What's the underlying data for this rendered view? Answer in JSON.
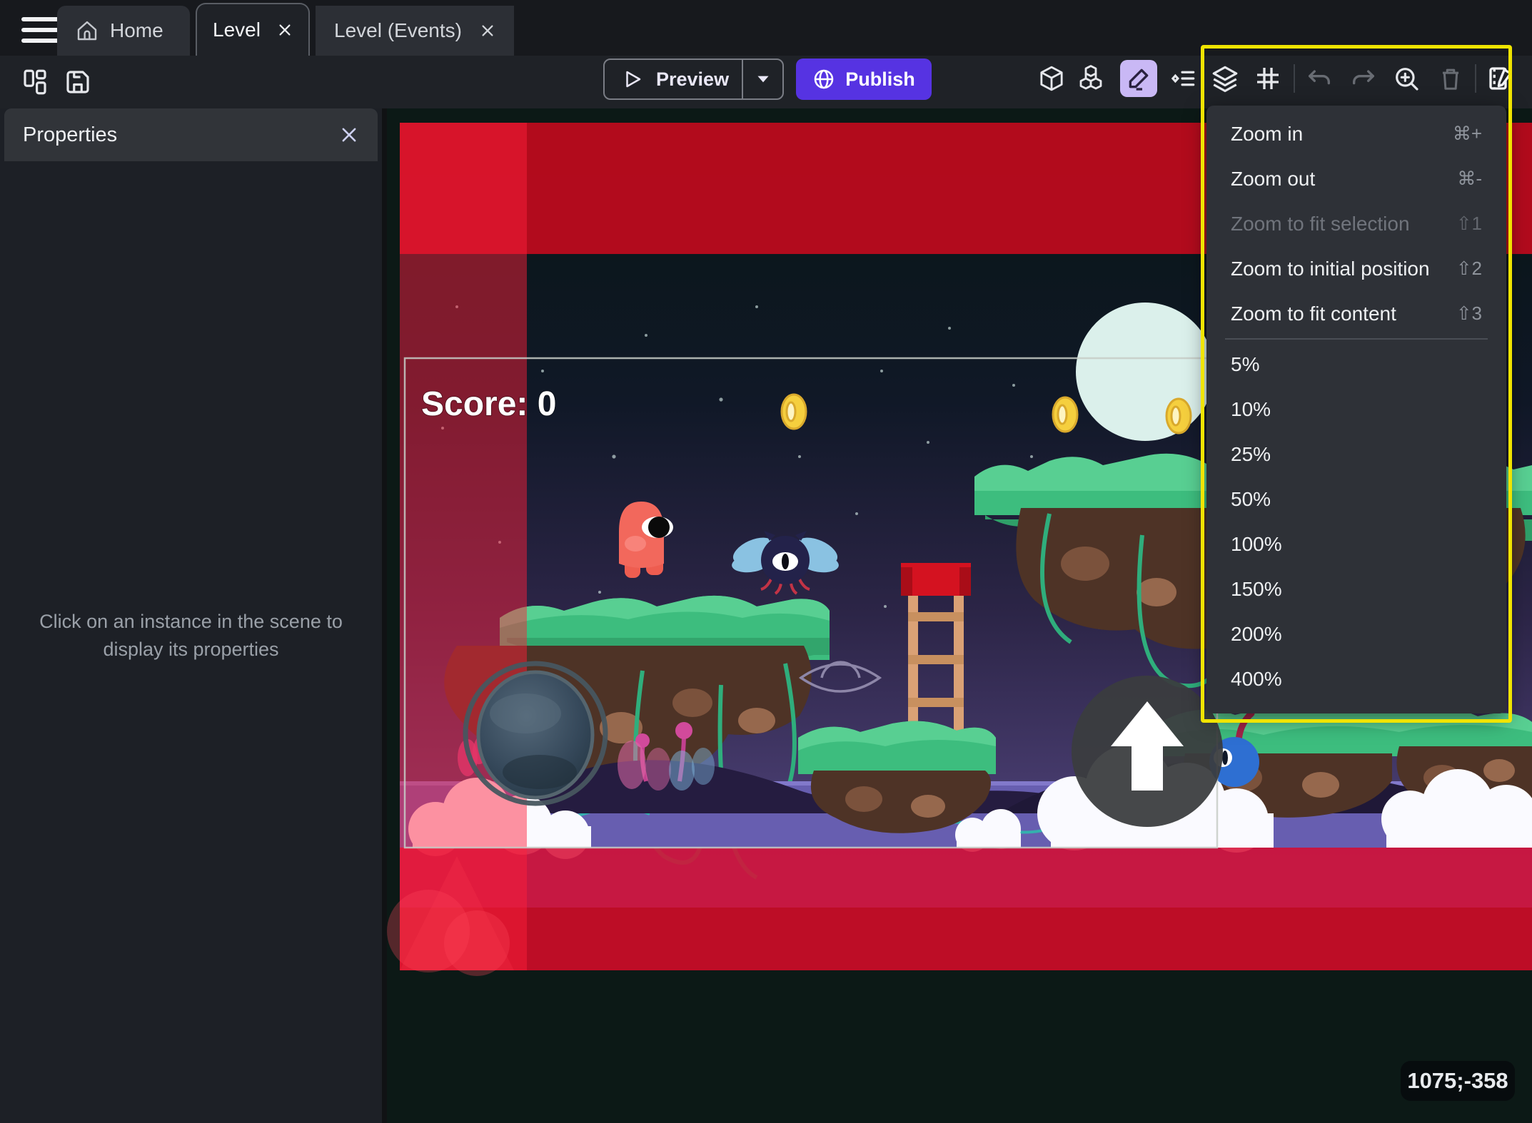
{
  "tab_bar": {
    "home": "Home",
    "level": "Level",
    "level_events": "Level (Events)"
  },
  "toolbar": {
    "preview": "Preview",
    "publish": "Publish"
  },
  "properties_panel": {
    "title": "Properties",
    "hint": "Click on an instance in the scene to display its properties"
  },
  "scene": {
    "score": "Score: 0",
    "cursor_coordinates": "1075;-358"
  },
  "zoom_menu": {
    "items": [
      {
        "label": "Zoom in",
        "shortcut": "⌘+"
      },
      {
        "label": "Zoom out",
        "shortcut": "⌘-"
      },
      {
        "label": "Zoom to fit selection",
        "shortcut": "⇧1"
      },
      {
        "label": "Zoom to initial position",
        "shortcut": "⇧2"
      },
      {
        "label": "Zoom to fit content",
        "shortcut": "⇧3"
      }
    ],
    "levels": [
      "5%",
      "10%",
      "25%",
      "50%",
      "100%",
      "150%",
      "200%",
      "400%"
    ]
  },
  "colors": {
    "accent_purple": "#5633e2",
    "highlight_yellow": "#f0e400",
    "selection_lavender": "#c9b8f5",
    "frame_red": "#c20b20"
  }
}
